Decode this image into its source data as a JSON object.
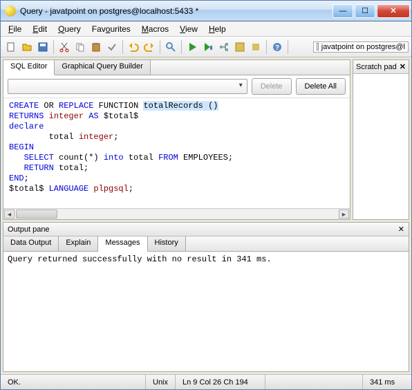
{
  "window": {
    "title": "Query - javatpoint on postgres@localhost:5433 *"
  },
  "menu": {
    "file": "File",
    "edit": "Edit",
    "query": "Query",
    "favourites": "Favourites",
    "macros": "Macros",
    "view": "View",
    "help": "Help"
  },
  "toolbar": {
    "connection_label": "javatpoint on postgres@l"
  },
  "editor": {
    "tabs": {
      "sql": "SQL Editor",
      "gqb": "Graphical Query Builder"
    },
    "buttons": {
      "delete": "Delete",
      "delete_all": "Delete All"
    },
    "code": {
      "l1a": "CREATE",
      "l1b": " OR ",
      "l1c": "REPLACE",
      "l1d": " FUNCTION ",
      "l1e": "totalRecords ()",
      "l2a": "RETURNS",
      "l2b": " integer ",
      "l2c": "AS",
      "l2d": " $total$",
      "l3a": "declare",
      "l4a": "        total ",
      "l4b": "integer",
      "l4c": ";",
      "l5a": "BEGIN",
      "l6a": "   SELECT",
      "l6b": " count(*) ",
      "l6c": "into",
      "l6d": " total ",
      "l6e": "FROM",
      "l6f": " EMPLOYEES;",
      "l7a": "   RETURN",
      "l7b": " total;",
      "l8a": "END",
      "l8b": ";",
      "l9a": "$total$ ",
      "l9b": "LANGUAGE",
      "l9c": " plpgsql",
      "l9d": ";"
    }
  },
  "scratch": {
    "title": "Scratch pad"
  },
  "output": {
    "title": "Output pane",
    "tabs": {
      "data": "Data Output",
      "explain": "Explain",
      "messages": "Messages",
      "history": "History"
    },
    "message": "Query returned successfully with no result in 341 ms."
  },
  "status": {
    "ok": "OK.",
    "enc": "Unix",
    "pos": "Ln 9 Col 26 Ch 194",
    "time": "341 ms"
  },
  "glyphs": {
    "min": "—",
    "max": "☐",
    "close": "✕",
    "scroll_left": "◄",
    "scroll_right": "►"
  }
}
